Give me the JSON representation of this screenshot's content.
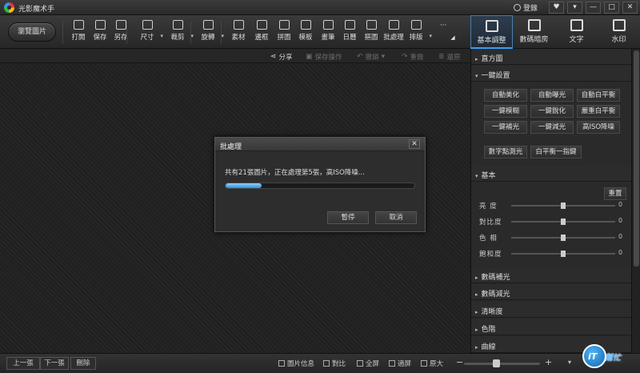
{
  "window": {
    "title": "光影魔术手",
    "login": "登錄",
    "controls": [
      "♥",
      "▾",
      "—",
      "□",
      "✕"
    ]
  },
  "toolbar": {
    "browse": "瀏覽圖片",
    "tools": [
      {
        "label": "打開",
        "icon": "open-icon",
        "caret": false
      },
      {
        "label": "保存",
        "icon": "save-icon",
        "caret": false
      },
      {
        "label": "另存",
        "icon": "save-as-icon",
        "caret": false
      },
      {
        "label": "尺寸",
        "icon": "resize-icon",
        "caret": true
      },
      {
        "label": "裁剪",
        "icon": "crop-icon",
        "caret": true
      },
      {
        "label": "旋轉",
        "icon": "rotate-icon",
        "caret": true
      },
      {
        "label": "素材",
        "icon": "material-icon",
        "caret": false
      },
      {
        "label": "邊框",
        "icon": "border-icon",
        "caret": false
      },
      {
        "label": "拼圖",
        "icon": "collage-icon",
        "caret": false
      },
      {
        "label": "模板",
        "icon": "template-icon",
        "caret": false
      },
      {
        "label": "畫筆",
        "icon": "brush-icon",
        "caret": false
      },
      {
        "label": "日曆",
        "icon": "calendar-icon",
        "caret": false
      },
      {
        "label": "摳圖",
        "icon": "cutout-icon",
        "caret": false
      },
      {
        "label": "批處理",
        "icon": "batch-icon",
        "caret": false
      },
      {
        "label": "排版",
        "icon": "layout-icon",
        "caret": true
      }
    ],
    "more": "···"
  },
  "right_tabs": [
    {
      "label": "基本調整",
      "icon": "adjust-icon",
      "active": true
    },
    {
      "label": "數碼暗房",
      "icon": "darkroom-icon",
      "active": false
    },
    {
      "label": "文字",
      "icon": "text-icon",
      "active": false
    },
    {
      "label": "水印",
      "icon": "watermark-icon",
      "active": false
    }
  ],
  "subbar": {
    "share": "分享",
    "save_op": "保存操作",
    "undo": "撤銷",
    "redo": "重做",
    "restore": "還原"
  },
  "dialog": {
    "title": "批處理",
    "message": "共有21張圖片，正在處理第5張，高ISO降噪...",
    "progress": 0.19,
    "pause": "暫停",
    "cancel": "取消"
  },
  "panel": {
    "histogram": "直方圖",
    "one_click": "一鍵設置",
    "one_click_buttons": [
      [
        "自動美化",
        "自動曝光",
        "自動白平衡"
      ],
      [
        "一鍵模糊",
        "一鍵銳化",
        "嚴重白平衡"
      ],
      [
        "一鍵補光",
        "一鍵減光",
        "高ISO降噪"
      ]
    ],
    "extra_buttons": [
      "數字點測光",
      "白平衡一指鍵"
    ],
    "basic": "基本",
    "reset": "重置",
    "sliders": [
      {
        "label": "亮 度",
        "value": "0",
        "pos": 0.5
      },
      {
        "label": "對比度",
        "value": "0",
        "pos": 0.5
      },
      {
        "label": "色 相",
        "value": "0",
        "pos": 0.5
      },
      {
        "label": "飽和度",
        "value": "0",
        "pos": 0.5
      }
    ],
    "sections": [
      "數碼補光",
      "數碼減光",
      "清晰度",
      "色階",
      "曲線"
    ]
  },
  "bottom": {
    "prev": "上一張",
    "next": "下一張",
    "delete": "刪除",
    "info": "圖片信息",
    "compare": "對比",
    "fullscreen": "全屏",
    "fit": "適屏",
    "original": "原大",
    "zoom_minus": "−",
    "zoom_plus": "+",
    "zoom_pos": 0.42
  },
  "watermark": {
    "it": "iT",
    "text": "幫忙"
  }
}
